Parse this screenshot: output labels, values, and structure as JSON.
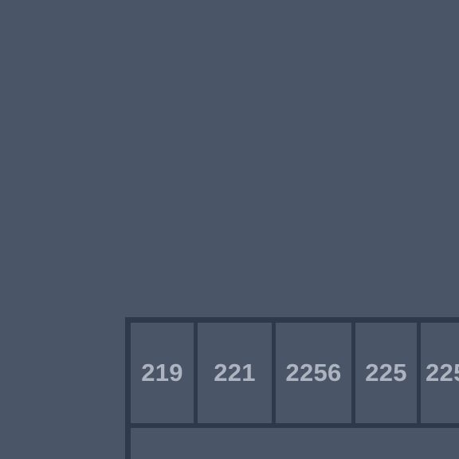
{
  "map": {
    "background_color": "#4a5567",
    "line_color": "#2e394a",
    "label_color": "#aeb4bf",
    "units": [
      {
        "label": "219"
      },
      {
        "label": "221"
      },
      {
        "label": "2256"
      },
      {
        "label": "225"
      },
      {
        "label": "225"
      }
    ]
  }
}
